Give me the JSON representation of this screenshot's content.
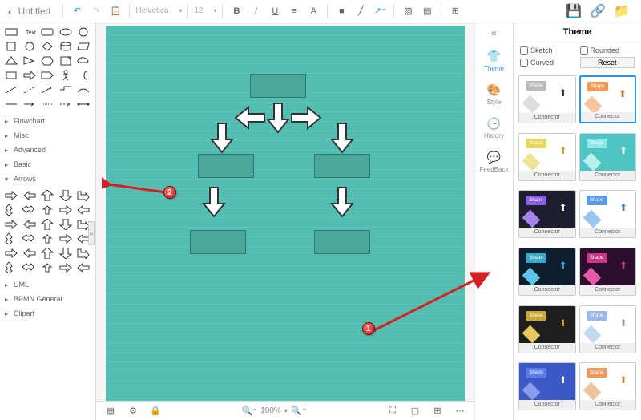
{
  "title": "Untitled",
  "toolbar": {
    "font": "Helvetica",
    "size": "12",
    "zoom": "100%"
  },
  "categories": [
    "Flowchart",
    "Misc",
    "Advanced",
    "Basic",
    "Arrows",
    "UML",
    "BPMN General",
    "Clipart"
  ],
  "rail": {
    "theme": "Theme",
    "style": "Style",
    "history": "History",
    "feedback": "FeedBack"
  },
  "theme": {
    "title": "Theme",
    "sketch": "Sketch",
    "rounded": "Rounded",
    "curved": "Curved",
    "reset": "Reset",
    "shape": "Shape",
    "connector": "Connector"
  },
  "theme_cards": [
    {
      "bg": "#ffffff",
      "c1": "#bbbbbb",
      "c2": "#dddddd",
      "arr": "#333333",
      "sel": false
    },
    {
      "bg": "#ffffff",
      "c1": "#f39a5a",
      "c2": "#f7c49b",
      "arr": "#c47030",
      "sel": true
    },
    {
      "bg": "#ffffff",
      "c1": "#e8d55a",
      "c2": "#f0e49b",
      "arr": "#b8a530",
      "sel": false
    },
    {
      "bg": "#4fc4c4",
      "c1": "#8de8e8",
      "c2": "#b8f0f0",
      "arr": "#ffffff",
      "sel": false
    },
    {
      "bg": "#1e1e2e",
      "c1": "#8b5ce8",
      "c2": "#a884ec",
      "arr": "#ffffff",
      "sel": false
    },
    {
      "bg": "#ffffff",
      "c1": "#5a9be8",
      "c2": "#9bc4f0",
      "arr": "#3a7bc8",
      "sel": false
    },
    {
      "bg": "#0e1e2e",
      "c1": "#3aa8c8",
      "c2": "#5ac8e8",
      "arr": "#3aa8c8",
      "sel": false
    },
    {
      "bg": "#2e0e2e",
      "c1": "#c83a88",
      "c2": "#e85aa8",
      "arr": "#c83a88",
      "sel": false
    },
    {
      "bg": "#1e1e1e",
      "c1": "#c8a83a",
      "c2": "#e8c85a",
      "arr": "#c8a83a",
      "sel": false
    },
    {
      "bg": "#ffffff",
      "c1": "#9bb8e8",
      "c2": "#c4d8f0",
      "arr": "#7b98c8",
      "sel": false
    },
    {
      "bg": "#3a5ac8",
      "c1": "#5a7be8",
      "c2": "#8b9bf0",
      "arr": "#ffffff",
      "sel": false
    },
    {
      "bg": "#ffffff",
      "c1": "#e89b5a",
      "c2": "#f0c49b",
      "arr": "#c87b3a",
      "sel": false
    }
  ],
  "markers": {
    "m1": "1",
    "m2": "2"
  }
}
